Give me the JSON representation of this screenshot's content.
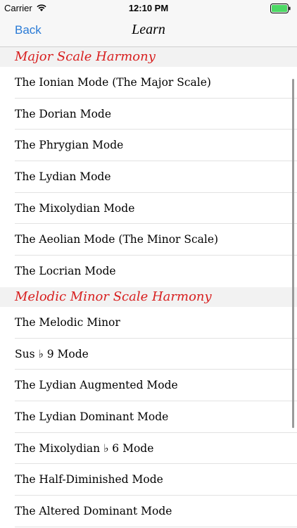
{
  "status_bar": {
    "carrier": "Carrier",
    "time": "12:10 PM"
  },
  "nav": {
    "back_label": "Back",
    "title": "Learn"
  },
  "sections": [
    {
      "title": "Major Scale Harmony",
      "items": [
        "The Ionian Mode (The Major Scale)",
        "The Dorian Mode",
        "The Phrygian Mode",
        "The Lydian Mode",
        "The Mixolydian Mode",
        "The Aeolian Mode (The Minor Scale)",
        "The Locrian Mode"
      ]
    },
    {
      "title": "Melodic Minor Scale Harmony",
      "items": [
        "The Melodic Minor",
        "Sus ♭ 9 Mode",
        "The Lydian Augmented Mode",
        "The Lydian Dominant Mode",
        "The Mixolydian ♭ 6 Mode",
        "The Half-Diminished Mode",
        "The Altered Dominant Mode"
      ]
    }
  ],
  "colors": {
    "accent": "#2a7bd6",
    "section_title": "#d81e1e",
    "battery": "#4cd964"
  }
}
